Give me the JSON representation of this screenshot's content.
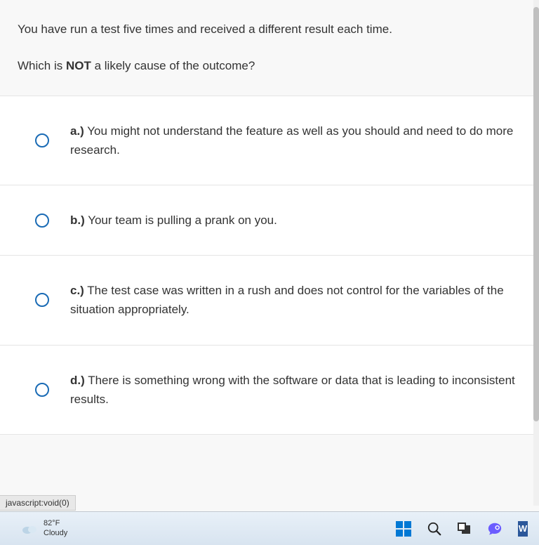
{
  "question": {
    "intro": "You have run a test five times and received a different result each time.",
    "prompt_before": "Which is ",
    "prompt_bold": "NOT",
    "prompt_after": " a likely cause of the outcome?"
  },
  "options": [
    {
      "letter": "a.)",
      "text": " You might not understand the feature as well as you should and need to do more research."
    },
    {
      "letter": "b.)",
      "text": " Your team is pulling a prank on you."
    },
    {
      "letter": "c.)",
      "text": " The test case was written in a rush and does not control for the variables of the situation appropriately."
    },
    {
      "letter": "d.)",
      "text": " There is something wrong with the software or data that is leading to inconsistent results."
    }
  ],
  "status_bar": {
    "text": "javascript:void(0)"
  },
  "taskbar": {
    "weather": {
      "temp": "82°F",
      "condition": "Cloudy"
    },
    "word_label": "W"
  }
}
